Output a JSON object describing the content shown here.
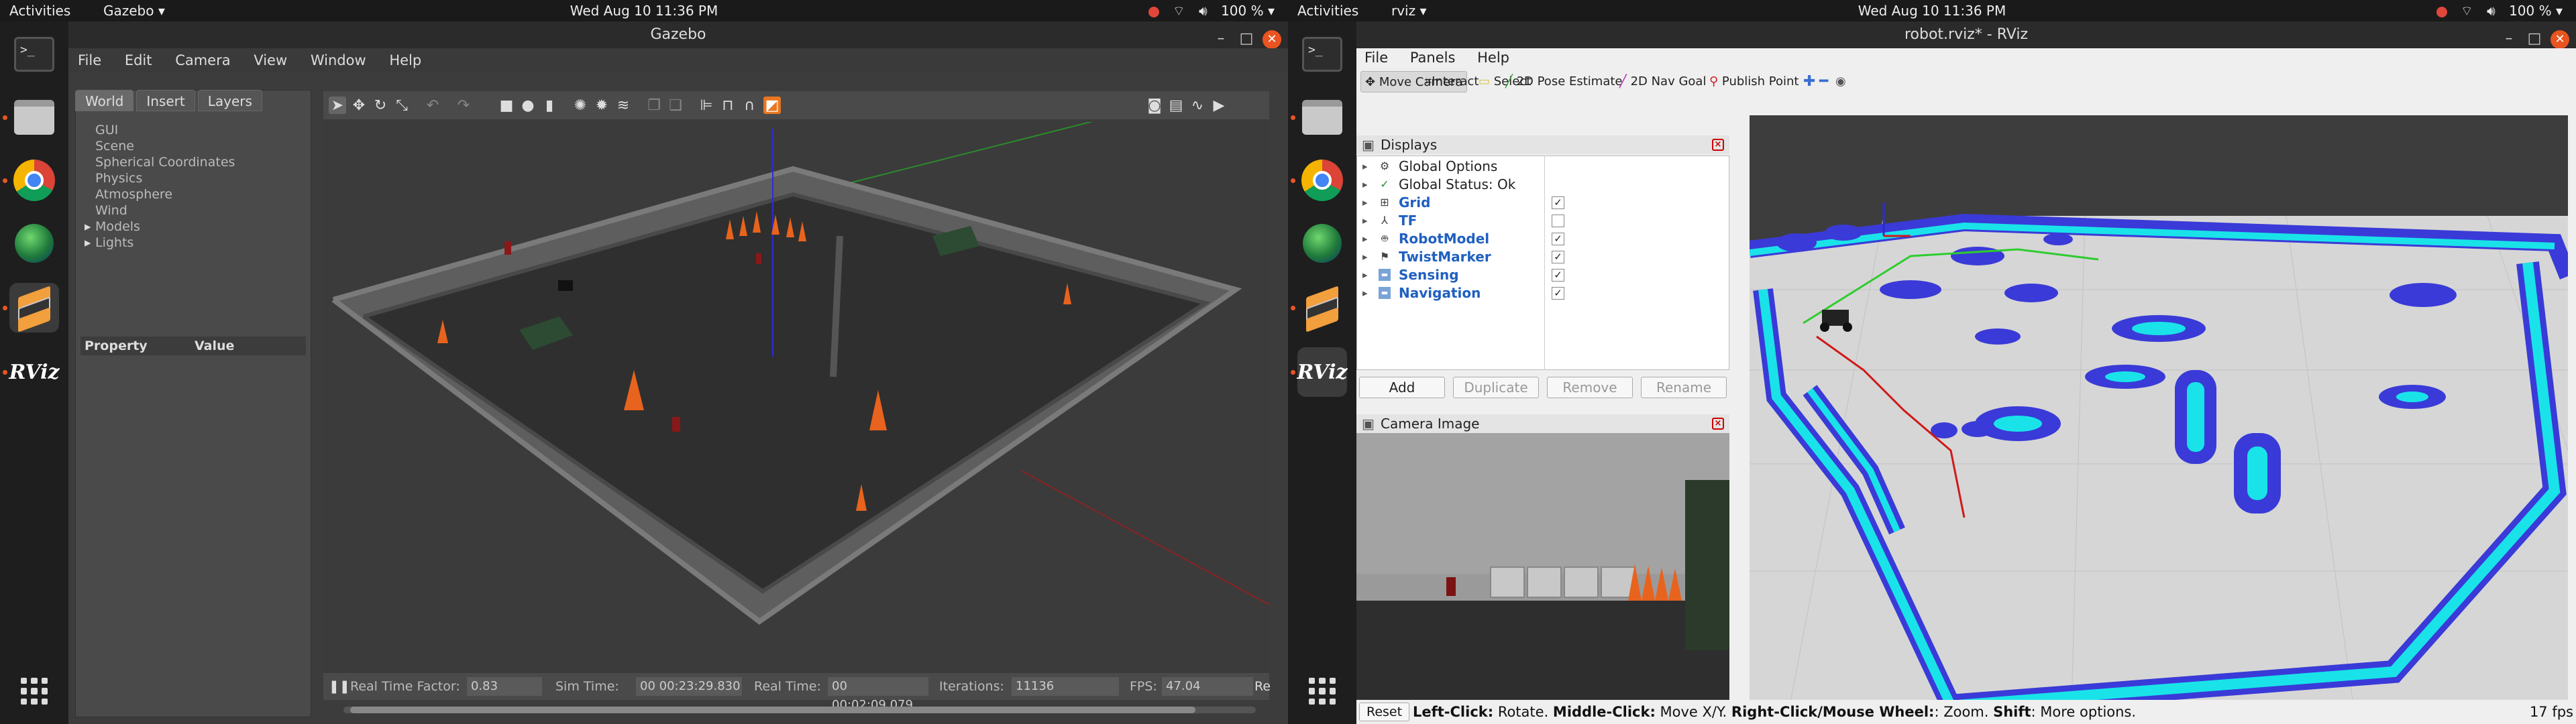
{
  "left": {
    "topbar": {
      "activities": "Activities",
      "app_menu": "Gazebo ▾",
      "clock": "Wed Aug 10  11:36 PM",
      "battery": "100 % ▾"
    },
    "window": {
      "title": "Gazebo",
      "menus": [
        "File",
        "Edit",
        "Camera",
        "View",
        "Window",
        "Help"
      ],
      "tabs": [
        "World",
        "Insert",
        "Layers"
      ],
      "tree": [
        {
          "label": "GUI",
          "expandable": false
        },
        {
          "label": "Scene",
          "expandable": false
        },
        {
          "label": "Spherical Coordinates",
          "expandable": false
        },
        {
          "label": "Physics",
          "expandable": false
        },
        {
          "label": "Atmosphere",
          "expandable": false
        },
        {
          "label": "Wind",
          "expandable": false
        },
        {
          "label": "Models",
          "expandable": true
        },
        {
          "label": "Lights",
          "expandable": true
        }
      ],
      "property_header": {
        "property": "Property",
        "value": "Value"
      },
      "status": {
        "rtf_label": "Real Time Factor:",
        "rtf": "0.83",
        "sim_label": "Sim Time:",
        "sim": "00 00:23:29.830",
        "real_label": "Real Time:",
        "real": "00 00:02:09.079",
        "iter_label": "Iterations:",
        "iter": "11136",
        "fps_label": "FPS:",
        "fps": "47.04",
        "reset_label": "Re"
      }
    }
  },
  "right": {
    "topbar": {
      "activities": "Activities",
      "app_menu": "rviz ▾",
      "clock": "Wed Aug 10  11:36 PM",
      "battery": "100 % ▾"
    },
    "window": {
      "title": "robot.rviz* - RViz",
      "menus": [
        "File",
        "Panels",
        "Help"
      ],
      "tools": [
        "Move Camera",
        "Interact",
        "Select",
        "2D Pose Estimate",
        "2D Nav Goal",
        "Publish Point"
      ],
      "displays_title": "Displays",
      "displays": [
        {
          "name": "Global Options",
          "blue": false,
          "check": null
        },
        {
          "name": "Global Status: Ok",
          "blue": false,
          "check": null
        },
        {
          "name": "Grid",
          "blue": true,
          "check": true
        },
        {
          "name": "TF",
          "blue": true,
          "check": false
        },
        {
          "name": "RobotModel",
          "blue": true,
          "check": true
        },
        {
          "name": "TwistMarker",
          "blue": true,
          "check": true
        },
        {
          "name": "Sensing",
          "blue": true,
          "check": true
        },
        {
          "name": "Navigation",
          "blue": true,
          "check": true
        }
      ],
      "buttons": [
        "Add",
        "Duplicate",
        "Remove",
        "Rename"
      ],
      "camera_title": "Camera Image",
      "status": {
        "reset": "Reset",
        "hint_parts": [
          {
            "b": "Left-Click:",
            "t": " Rotate. "
          },
          {
            "b": "Middle-Click:",
            "t": " Move X/Y. "
          },
          {
            "b": "Right-Click/Mouse Wheel:",
            "t": ": Zoom. "
          },
          {
            "b": "Shift",
            "t": ": More options."
          }
        ],
        "fps": "17 fps"
      }
    }
  },
  "colors": {
    "ubuntu_orange": "#e95420",
    "rviz_blue": "#2060c0",
    "costmap_cyan": "#19e3e8",
    "costmap_blue": "#3a3ad8"
  }
}
